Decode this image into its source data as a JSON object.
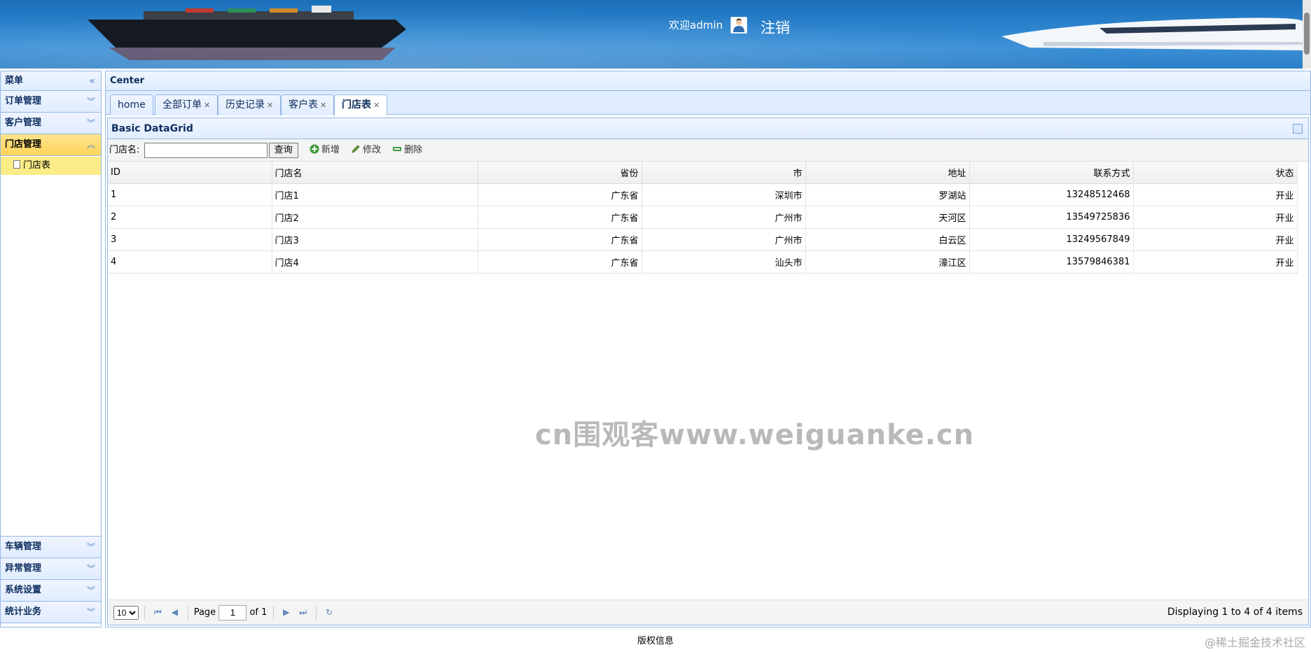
{
  "header": {
    "welcome": "欢迎admin",
    "logout": "注销"
  },
  "menu": {
    "title": "菜单",
    "collapse": "«",
    "items": [
      {
        "label": "订单管理"
      },
      {
        "label": "客户管理"
      },
      {
        "label": "门店管理"
      },
      {
        "label": "车辆管理"
      },
      {
        "label": "异常管理"
      },
      {
        "label": "系统设置"
      },
      {
        "label": "统计业务"
      }
    ],
    "active_child": "门店表"
  },
  "center": {
    "title": "Center",
    "tabs": [
      {
        "label": "home"
      },
      {
        "label": "全部订单"
      },
      {
        "label": "历史记录"
      },
      {
        "label": "客户表"
      },
      {
        "label": "门店表"
      }
    ]
  },
  "datagrid": {
    "title": "Basic DataGrid",
    "toolbar": {
      "search_label": "门店名:",
      "search_value": "",
      "query_button": "查询",
      "add_button": "新增",
      "edit_button": "修改",
      "delete_button": "删除"
    },
    "columns": [
      "ID",
      "门店名",
      "省份",
      "市",
      "地址",
      "联系方式",
      "状态"
    ],
    "rows": [
      [
        "1",
        "门店1",
        "广东省",
        "深圳市",
        "罗湖站",
        "13248512468",
        "开业"
      ],
      [
        "2",
        "门店2",
        "广东省",
        "广州市",
        "天河区",
        "13549725836",
        "开业"
      ],
      [
        "3",
        "门店3",
        "广东省",
        "广州市",
        "白云区",
        "13249567849",
        "开业"
      ],
      [
        "4",
        "门店4",
        "广东省",
        "汕头市",
        "濠江区",
        "13579846381",
        "开业"
      ]
    ],
    "watermark": "cn围观客www.weiguanke.cn",
    "pager": {
      "page_size": "10",
      "page_label": "Page",
      "page_value": "1",
      "of_label": "of 1",
      "info": "Displaying 1 to 4 of 4 items"
    }
  },
  "footer": {
    "text": "版权信息",
    "credit": "@稀土掘金技术社区"
  },
  "colors": {
    "panel_border": "#95b8e7",
    "panel_header": "#e0ecff",
    "active_menu": "#ffd45c"
  }
}
